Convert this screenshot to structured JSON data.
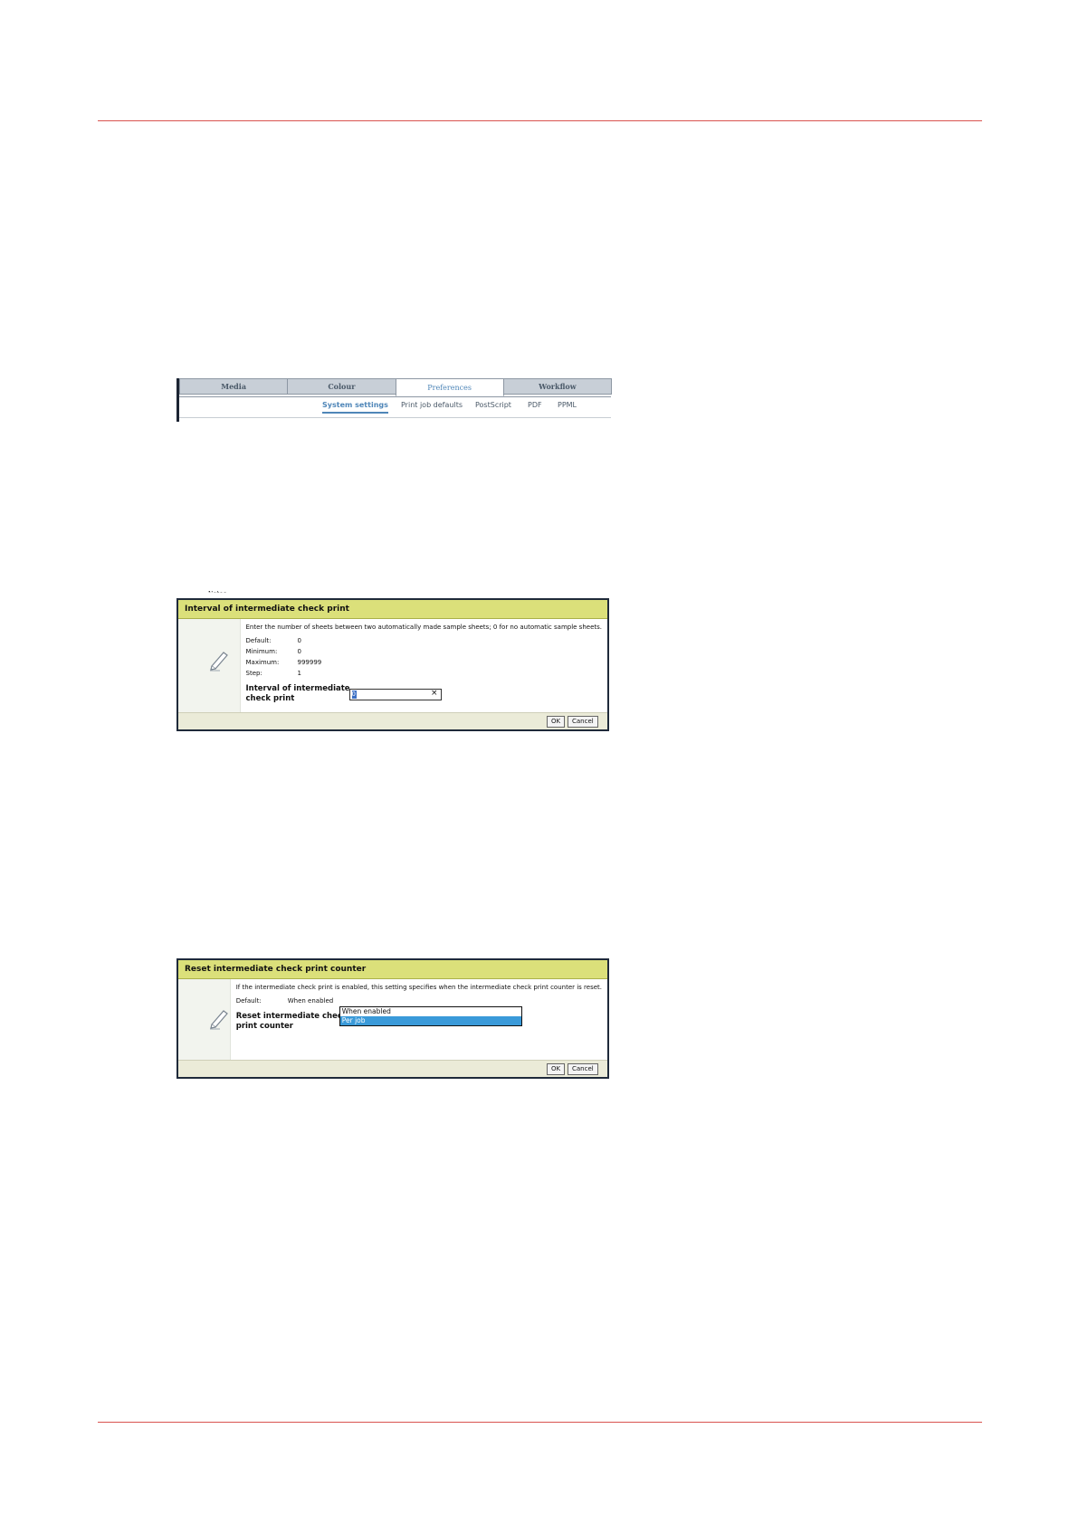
{
  "tabs": {
    "main": [
      {
        "label": "Media",
        "active": false
      },
      {
        "label": "Colour",
        "active": false
      },
      {
        "label": "Preferences",
        "active": true
      },
      {
        "label": "Workflow",
        "active": false
      }
    ],
    "sub": [
      {
        "label": "System settings",
        "active": true
      },
      {
        "label": "Print job defaults",
        "active": false
      },
      {
        "label": "PostScript",
        "active": false
      },
      {
        "label": "PDF",
        "active": false
      },
      {
        "label": "PPML",
        "active": false
      }
    ]
  },
  "partial_text": "Notes",
  "dialog1": {
    "title": "Interval of intermediate check print",
    "description": "Enter the number of sheets between two automatically made sample sheets; 0 for no automatic sample sheets.",
    "rows": [
      {
        "label": "Default:",
        "value": "0"
      },
      {
        "label": "Minimum:",
        "value": "0"
      },
      {
        "label": "Maximum:",
        "value": "999999"
      },
      {
        "label": "Step:",
        "value": "1"
      }
    ],
    "field_label_line1": "Interval of intermediate",
    "field_label_line2": "check print",
    "input_value": "0",
    "clear_icon": "×",
    "ok": "OK",
    "cancel": "Cancel"
  },
  "dialog2": {
    "title": "Reset intermediate check print counter",
    "description": "If the intermediate check print is enabled, this setting specifies when the intermediate check print counter is reset.",
    "default_label": "Default:",
    "default_value": "When enabled",
    "field_label_line1": "Reset intermediate check",
    "field_label_line2": "print counter",
    "options": [
      "When enabled",
      "Per job"
    ],
    "selected": "Per job",
    "ok": "OK",
    "cancel": "Cancel"
  },
  "colors": {
    "rule": "#d9534f",
    "title_bar": "#dbe07a",
    "accent": "#4f86b8",
    "selection": "#3a9ad9"
  },
  "icons": {
    "dialog_icon": "pencil-icon"
  }
}
